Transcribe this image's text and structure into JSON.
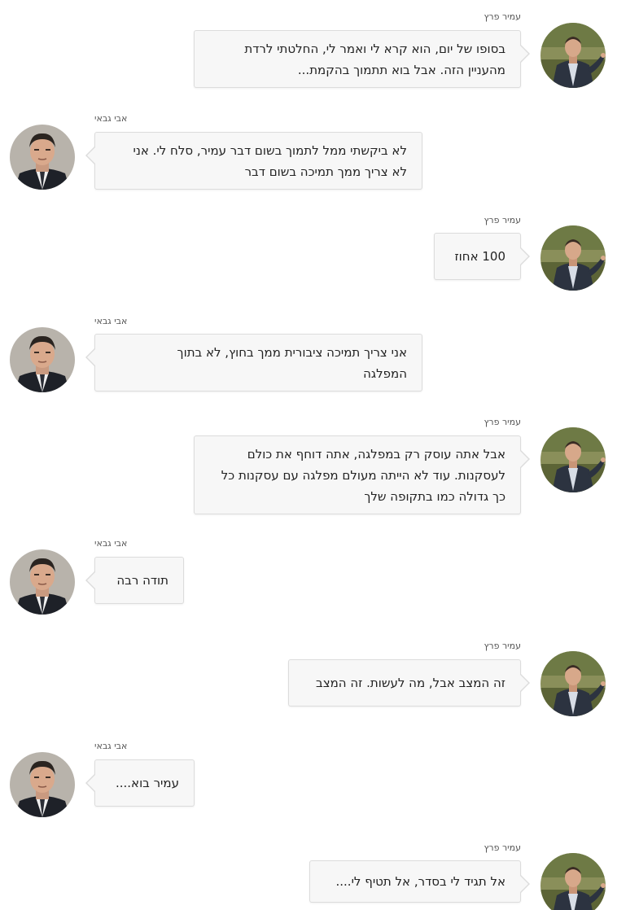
{
  "participants": {
    "amir": {
      "name": "עמיר פרץ"
    },
    "avi": {
      "name": "אבי גבאי"
    }
  },
  "messages": [
    {
      "sender": "עמיר פרץ",
      "lines": [
        "בסופו של יום, הוא קרא לי ואמר לי, החלטתי לרדת",
        "מהעניין הזה. אבל בוא תתמוך בהקמת..."
      ]
    },
    {
      "sender": "אבי גבאי",
      "lines": [
        "לא ביקשתי ממל לתמוך בשום דבר עמיר, סלח לי. אני",
        "לא צריך ממך תמיכה בשום דבר"
      ]
    },
    {
      "sender": "עמיר פרץ",
      "lines": [
        "100 אחוז"
      ]
    },
    {
      "sender": "אבי גבאי",
      "lines": [
        "אני צריך תמיכה ציבורית ממך בחוץ, לא בתוך",
        "המפלגה"
      ]
    },
    {
      "sender": "עמיר פרץ",
      "lines": [
        "אבל אתה עוסק רק במפלגה, אתה דוחף את כולם",
        "לעסקנות. עוד לא הייתה מעולם מפלגה עם עסקנות כל",
        "כך גדולה כמו בתקופה שלך"
      ]
    },
    {
      "sender": "אבי גבאי",
      "lines": [
        "תודה רבה"
      ]
    },
    {
      "sender": "עמיר פרץ",
      "lines": [
        "זה המצב אבל, מה לעשות. זה המצב"
      ]
    },
    {
      "sender": "אבי גבאי",
      "lines": [
        "עמיר בוא...."
      ]
    },
    {
      "sender": "עמיר פרץ",
      "lines": [
        "אל תגיד לי בסדר, אל תטיף לי...."
      ]
    }
  ],
  "colors": {
    "bubble_bg": "#f7f7f7",
    "bubble_border": "#dcdcdc",
    "text": "#222222",
    "name_text": "#555555"
  },
  "icons": {
    "amir_avatar": "avatar-amir-icon",
    "avi_avatar": "avatar-avi-icon"
  }
}
